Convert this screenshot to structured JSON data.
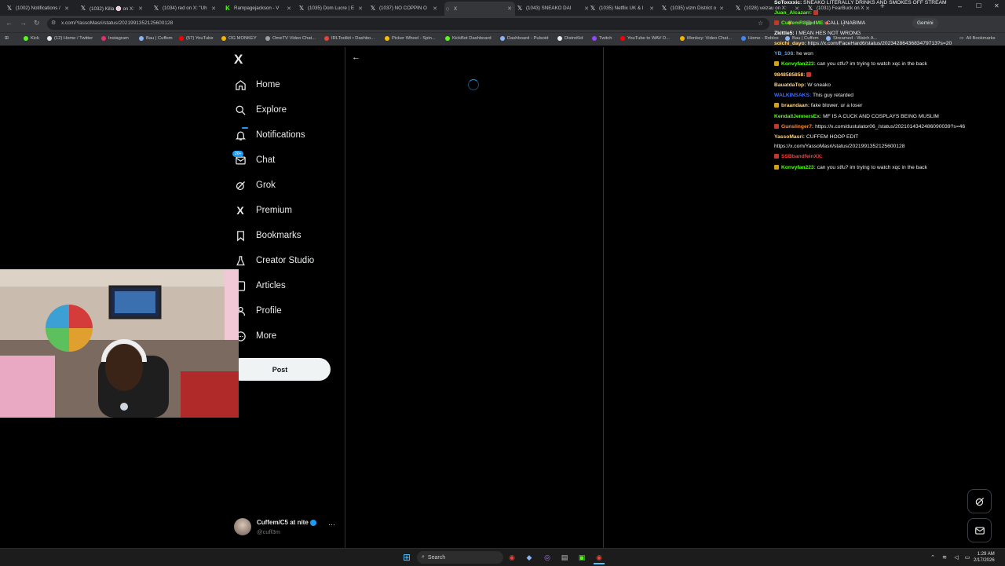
{
  "tabs": [
    {
      "label": "(1002) Notifications /"
    },
    {
      "label": "(1032) Killa 🍥 on X:"
    },
    {
      "label": "(1034) red on X: \"Uh"
    },
    {
      "label": "Rampagejackson - V"
    },
    {
      "label": "(1035) Dom Lucre | E"
    },
    {
      "label": "(1037) NO COPPIN O"
    },
    {
      "label": "X"
    },
    {
      "label": "(1043) SNEAKO DAI"
    },
    {
      "label": "(1035) Netflix UK & I"
    },
    {
      "label": "(1035) vizm District o"
    },
    {
      "label": "(1028) veizau on X:"
    },
    {
      "label": "(1031) FearBuck on X"
    }
  ],
  "browser": {
    "url": "x.com/YassoMasri/status/2021991352125600128",
    "gemini": "Gemini",
    "all_bookmarks": "All Bookmarks"
  },
  "bookmarks": [
    "Kick",
    "(12) Home / Twitter",
    "Instagram",
    "Bau | Cuffem",
    "(57) YouTube",
    "OG MONKEY",
    "OmeTV Video Chat...",
    "IRLToolkit • Dashbo...",
    "Picker Wheel - Spin...",
    "KickBot Dashboard",
    "Dashboard - Pulsoid",
    "DistroKid",
    "Twitch",
    "YouTube to WAV D...",
    "Monkey: Video Chat...",
    "Home - Roblox",
    "Bau | Cuffem",
    "Streamed - Watch A..."
  ],
  "nav": {
    "logo": "X",
    "items": [
      {
        "label": "Home"
      },
      {
        "label": "Explore"
      },
      {
        "label": "Notifications"
      },
      {
        "label": "Chat"
      },
      {
        "label": "Grok"
      },
      {
        "label": "Premium"
      },
      {
        "label": "Bookmarks"
      },
      {
        "label": "Creator Studio"
      },
      {
        "label": "Articles"
      },
      {
        "label": "Profile"
      },
      {
        "label": "More"
      }
    ],
    "chat_badge": "20+",
    "post_label": "Post"
  },
  "account": {
    "name": "Cuffem/C5 at nite",
    "handle": "@cuff3m"
  },
  "chat": [
    {
      "user": "SoToxxxic:",
      "text": "SNEAKO LITERALLY DRINKS AND SMOKES OFF STREAM",
      "color": "#ffffff"
    },
    {
      "user": "Juan_Alcazarr:",
      "text": "",
      "color": "#53fc18"
    },
    {
      "user": "CuffemR8pedME:",
      "text": "CALL LINABIMA",
      "color": "#53fc18"
    },
    {
      "user": "Zkittle5:",
      "text": "I MEAN HES NOT WRONG",
      "color": "#ffffff"
    },
    {
      "user": "soichi_dayo:",
      "text": "https://x.com/FaceHard6/status/2023428643683479713?s=20",
      "color": "#ffd27f"
    },
    {
      "user": "YB_108:",
      "text": "he won",
      "color": "#4ba3ff"
    },
    {
      "user": "Konvyfan223:",
      "text": "can you stfu? im trying to watch xqc in the back",
      "color": "#53fc18"
    },
    {
      "user": "9848585858:",
      "text": "",
      "color": "#ffd27f"
    },
    {
      "user": "BauatdaTop:",
      "text": "W sneako",
      "color": "#ffd27f"
    },
    {
      "user": "WALKINSAKS:",
      "text": "This guy retarded",
      "color": "#3f6fff"
    },
    {
      "user": "braandaan:",
      "text": "fake blower. ur a loser",
      "color": "#ffd27f"
    },
    {
      "user": "KendallJennersEx:",
      "text": "MF IS A CUCK AND COSPLAYS BEING MUSLIM",
      "color": "#53fc18"
    },
    {
      "user": "Gunslinger7:",
      "text": "https://x.com/dustulator06_/status/2021014342486090039?s=46",
      "color": "#ff8c3a"
    },
    {
      "user": "YassoMasri:",
      "text": "CUFFEM HOOP EDIT",
      "color": "#ffd27f"
    },
    {
      "user": "",
      "text": "https://x.com/YassoMasri/status/2021991352125600128",
      "color": "#ffffff"
    },
    {
      "user": "SSBbandfeinXX:",
      "text": "",
      "color": "#ff3b3b"
    },
    {
      "user": "Konvyfan223:",
      "text": "can you stfu? im trying to watch xqc in the back",
      "color": "#53fc18"
    }
  ],
  "taskbar": {
    "search": "Search",
    "time": "1:29 AM",
    "date": "2/17/2026"
  }
}
